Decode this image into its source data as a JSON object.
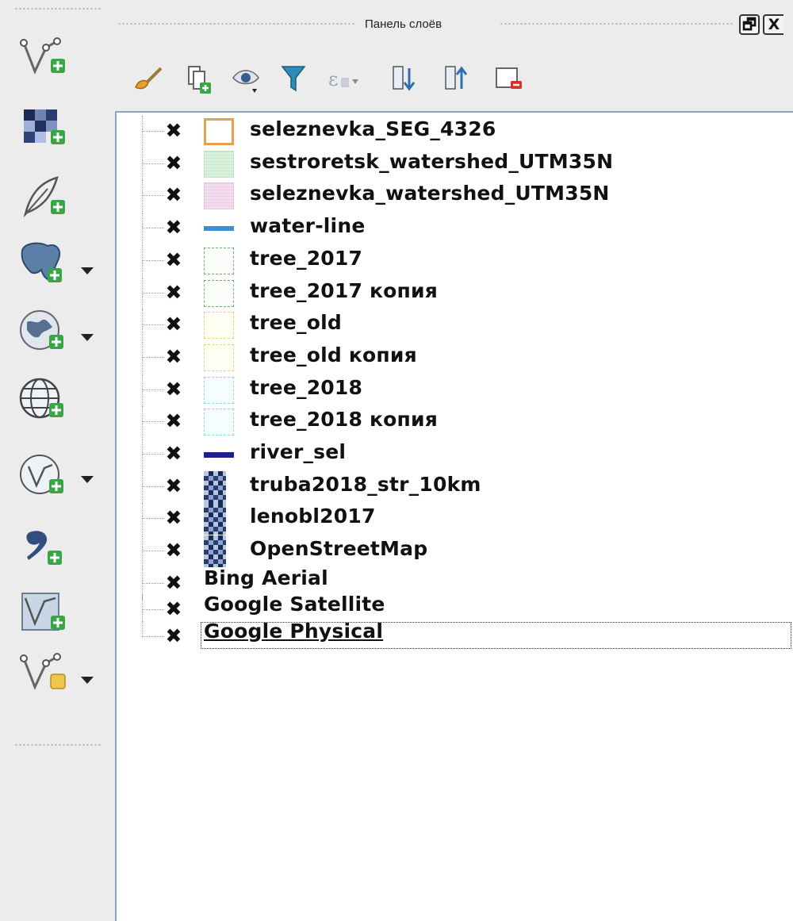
{
  "panel": {
    "title": "Панель слоёв",
    "float_button": "🗗",
    "close_button": "X"
  },
  "left_toolbar": {
    "tools": [
      {
        "icon": "add-vector-layer-icon",
        "dropdown": false
      },
      {
        "icon": "add-raster-layer-icon",
        "dropdown": false
      },
      {
        "icon": "add-delimited-text-layer-icon",
        "dropdown": false
      },
      {
        "icon": "add-postgis-layer-icon",
        "dropdown": true
      },
      {
        "icon": "add-wms-layer-icon",
        "dropdown": true
      },
      {
        "icon": "add-wcs-layer-icon",
        "dropdown": false
      },
      {
        "icon": "add-wfs-layer-icon",
        "dropdown": true
      },
      {
        "icon": "add-virtual-layer-icon",
        "dropdown": false
      },
      {
        "icon": "add-mesh-layer-icon",
        "dropdown": false
      },
      {
        "icon": "new-layer-icon",
        "dropdown": true
      }
    ]
  },
  "panel_toolbar": {
    "tools": [
      {
        "icon": "style-brush-icon"
      },
      {
        "icon": "add-group-icon"
      },
      {
        "icon": "manage-visibility-icon"
      },
      {
        "icon": "filter-legend-icon"
      },
      {
        "icon": "filter-by-expression-icon"
      },
      {
        "icon": "expand-all-icon"
      },
      {
        "icon": "collapse-all-icon"
      },
      {
        "icon": "remove-layer-icon"
      }
    ]
  },
  "colors": {
    "tree_border": "#8aa5c8",
    "orange": "#e8a04c",
    "water_blue": "#3d8fd1",
    "river_navy": "#1f1f8f"
  },
  "layers": [
    {
      "name": "seleznevka_SEG_4326",
      "checked": "✖",
      "symbol": "box-orange"
    },
    {
      "name": "sestroretsk_watershed_UTM35N",
      "checked": "✖",
      "symbol": "box-green"
    },
    {
      "name": "seleznevka_watershed_UTM35N",
      "checked": "✖",
      "symbol": "box-pink"
    },
    {
      "name": "water-line",
      "checked": "✖",
      "symbol": "line-blue"
    },
    {
      "name": "tree_2017",
      "checked": "✖",
      "symbol": "box-green-dashed"
    },
    {
      "name": "tree_2017 копия",
      "checked": "✖",
      "symbol": "box-green-dashed"
    },
    {
      "name": "tree_old",
      "checked": "✖",
      "symbol": "box-yellow"
    },
    {
      "name": "tree_old копия",
      "checked": "✖",
      "symbol": "box-yellow"
    },
    {
      "name": "tree_2018",
      "checked": "✖",
      "symbol": "box-cyan"
    },
    {
      "name": "tree_2018 копия",
      "checked": "✖",
      "symbol": "box-cyan"
    },
    {
      "name": "river_sel",
      "checked": "✖",
      "symbol": "line-navy"
    },
    {
      "name": "truba2018_str_10km",
      "checked": "✖",
      "symbol": "raster"
    },
    {
      "name": "lenobl2017",
      "checked": "✖",
      "symbol": "raster"
    },
    {
      "name": "OpenStreetMap",
      "checked": "✖",
      "symbol": "raster"
    },
    {
      "name": "Bing Aerial",
      "checked": "✖",
      "symbol": "none"
    },
    {
      "name": "Google Satellite",
      "checked": "✖",
      "symbol": "none"
    },
    {
      "name": "Google Physical",
      "checked": "✖",
      "symbol": "none"
    }
  ]
}
